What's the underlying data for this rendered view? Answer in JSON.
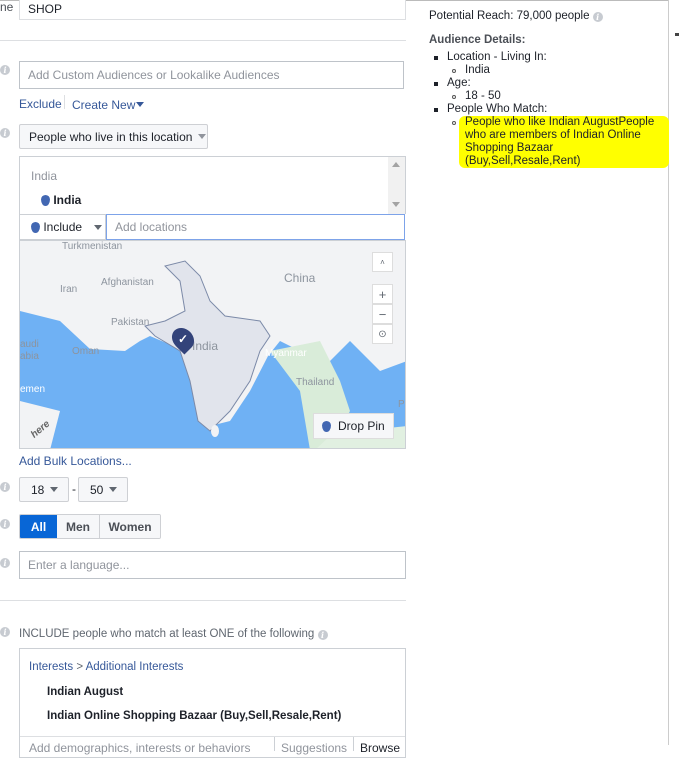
{
  "name_label": "ne",
  "name_value": "SHOP",
  "custom_audience": {
    "placeholder": "Add Custom Audiences or Lookalike Audiences",
    "exclude": "Exclude",
    "create_new": "Create New"
  },
  "location": {
    "type_select": "People who live in this location",
    "list_header": "India",
    "selected": "India",
    "include": "Include",
    "add_placeholder": "Add locations",
    "bulk": "Add Bulk Locations...",
    "drop_pin": "Drop Pin",
    "map_labels": [
      "Turkmenistan",
      "Iran",
      "Afghanistan",
      "Pakistan",
      "China",
      "India",
      "Oman",
      "audi",
      "abia",
      "emen",
      "Myanmar",
      "Thailand",
      "Ph",
      "here"
    ]
  },
  "age": {
    "min": "18",
    "max": "50",
    "sep": "-"
  },
  "gender": {
    "options": [
      "All",
      "Men",
      "Women"
    ],
    "selected": "All"
  },
  "language": {
    "placeholder": "Enter a language..."
  },
  "detailed": {
    "heading": "INCLUDE people who match at least ONE of the following",
    "crumb1": "Interests",
    "crumb_sep": ">",
    "crumb2": "Additional Interests",
    "items": [
      "Indian August",
      "Indian Online Shopping Bazaar (Buy,Sell,Resale,Rent)"
    ],
    "add_placeholder": "Add demographics, interests or behaviors",
    "suggestions": "Suggestions",
    "browse": "Browse"
  },
  "summary": {
    "reach": "Potential Reach: 79,000 people",
    "details_title": "Audience Details:",
    "items": [
      {
        "label": "Location - Living In:",
        "sub": "India"
      },
      {
        "label": "Age:",
        "sub": "18 - 50"
      },
      {
        "label": "People Who Match:",
        "sub": "People who like Indian AugustPeople who are members of Indian Online Shopping Bazaar (Buy,Sell,Resale,Rent)"
      }
    ]
  },
  "colors": {
    "accent": "#4267b2",
    "selected_btn": "#0866d6",
    "highlight": "#ffff00"
  }
}
